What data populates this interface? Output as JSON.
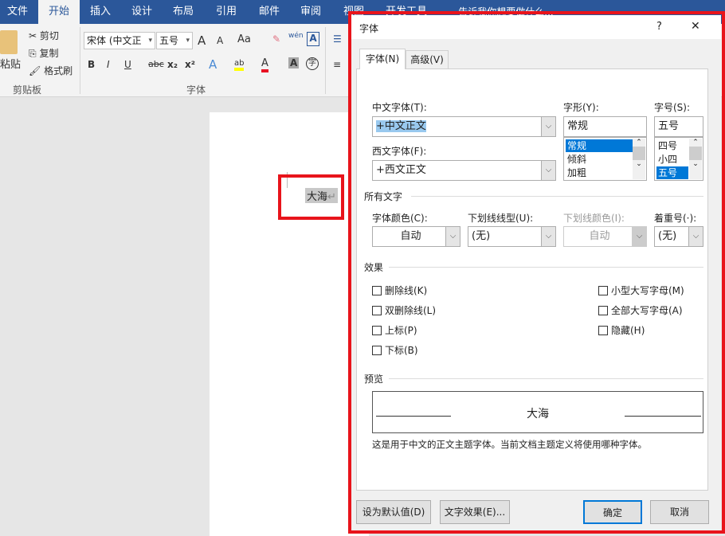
{
  "ribbon_tabs": [
    "文件",
    "开始",
    "插入",
    "设计",
    "布局",
    "引用",
    "邮件",
    "审阅",
    "视图",
    "开发工具"
  ],
  "tell_me": "告诉我你想要做什么...",
  "clipboard": {
    "paste": "粘贴",
    "cut": "剪切",
    "copy": "复制",
    "format_painter": "格式刷",
    "group": "剪贴板"
  },
  "font_group": {
    "font_name": "宋体 (中文正文)",
    "font_size": "五号",
    "group": "字体",
    "bold": "B",
    "italic": "I",
    "underline": "U",
    "strike": "abc",
    "sub": "x₂",
    "sup": "x²",
    "grow": "A",
    "shrink": "A",
    "case": "Aa",
    "phonetic": "wén",
    "enclose": "字"
  },
  "document": {
    "text": "大海",
    "mark": "↵"
  },
  "dialog": {
    "title": "字体",
    "help": "?",
    "close": "✕",
    "tabs": [
      "字体(N)",
      "高级(V)"
    ],
    "cn_font_label": "中文字体(T):",
    "cn_font": "+中文正文",
    "west_font_label": "西文字体(F):",
    "west_font": "+西文正文",
    "style_label": "字形(Y):",
    "style_value": "常规",
    "styles": [
      "常规",
      "倾斜",
      "加粗"
    ],
    "size_label": "字号(S):",
    "size_value": "五号",
    "sizes": [
      "四号",
      "小四",
      "五号"
    ],
    "all_text": "所有文字",
    "color_label": "字体颜色(C):",
    "color_value": "自动",
    "underline_label": "下划线线型(U):",
    "underline_value": "(无)",
    "underline_color_label": "下划线颜色(I):",
    "underline_color_value": "自动",
    "emphasis_label": "着重号(·):",
    "emphasis_value": "(无)",
    "effects": "效果",
    "effects_left": [
      "删除线(K)",
      "双删除线(L)",
      "上标(P)",
      "下标(B)"
    ],
    "effects_right": [
      "小型大写字母(M)",
      "全部大写字母(A)",
      "隐藏(H)"
    ],
    "preview": "预览",
    "preview_text": "大海",
    "preview_note": "这是用于中文的正文主题字体。当前文档主题定义将使用哪种字体。",
    "set_default": "设为默认值(D)",
    "text_effects": "文字效果(E)...",
    "ok": "确定",
    "cancel": "取消"
  }
}
